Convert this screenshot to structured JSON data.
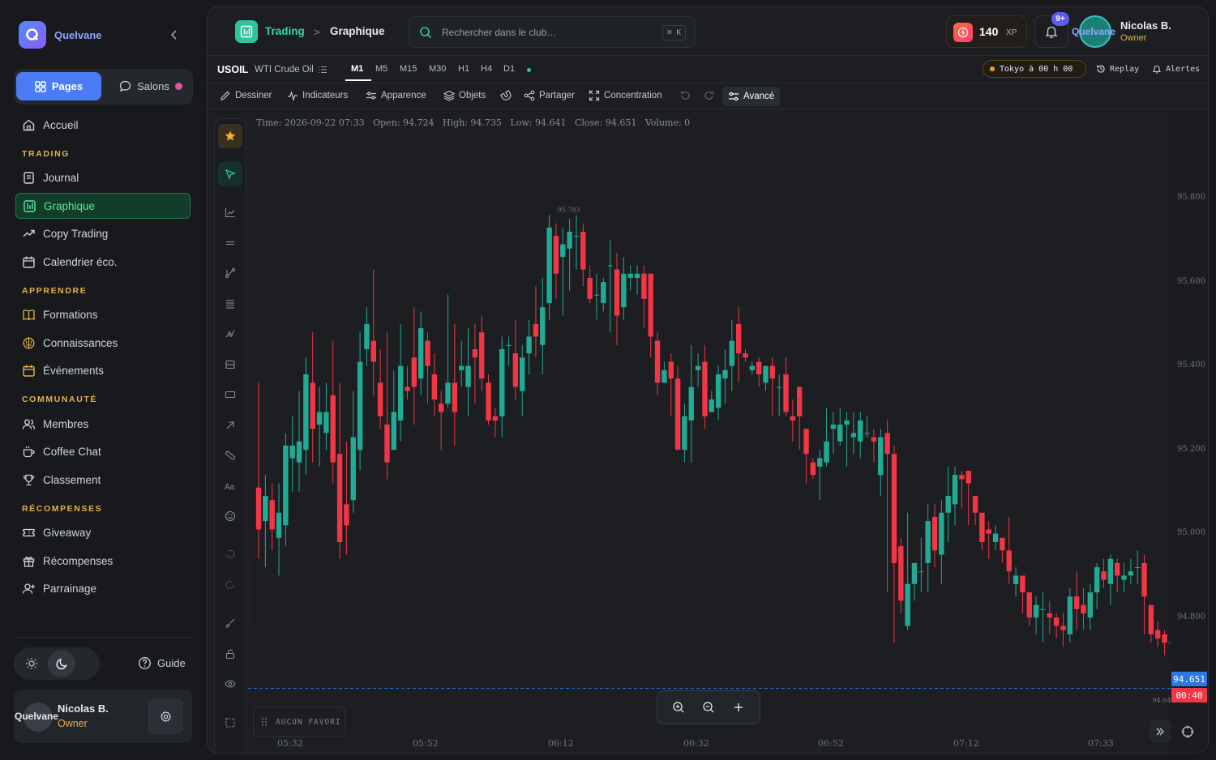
{
  "app": {
    "brand": "Quelvane"
  },
  "sidebar": {
    "tabs": {
      "pages": "Pages",
      "salons": "Salons"
    },
    "sections": {
      "trading": "TRADING",
      "apprendre": "APPRENDRE",
      "communaute": "COMMUNAUTÉ",
      "recompenses": "RÉCOMPENSES"
    },
    "items": {
      "accueil": "Accueil",
      "journal": "Journal",
      "graphique": "Graphique",
      "copy_trading": "Copy Trading",
      "calendrier": "Calendrier éco.",
      "formations": "Formations",
      "connaissances": "Connaissances",
      "evenements": "Événements",
      "membres": "Membres",
      "coffee_chat": "Coffee Chat",
      "classement": "Classement",
      "giveaway": "Giveaway",
      "recompenses": "Récompenses",
      "parrainage": "Parrainage"
    },
    "guide": "Guide",
    "user": {
      "brand": "Quelvane",
      "name": "Nicolas B.",
      "role": "Owner"
    }
  },
  "header": {
    "breadcrumb": {
      "section": "Trading",
      "page": "Graphique",
      "separator": ">"
    },
    "search": {
      "placeholder": "Rechercher dans le club…",
      "shortcut": "⌘ K"
    },
    "xp": {
      "value": "140",
      "unit": "XP"
    },
    "notifications": {
      "badge": "9+"
    },
    "user": {
      "brand": "Quelvane",
      "name": "Nicolas B.",
      "role": "Owner"
    }
  },
  "symbol_bar": {
    "symbol": "USOIL",
    "name": "WTI Crude Oil",
    "timeframes": [
      "M1",
      "M5",
      "M15",
      "M30",
      "H1",
      "H4",
      "D1"
    ],
    "active_timeframe": "M1",
    "session": "Tokyo à 00 h 00",
    "replay": "Replay",
    "alerts": "Alertes"
  },
  "toolbar": {
    "dessiner": "Dessiner",
    "indicateurs": "Indicateurs",
    "apparence": "Apparence",
    "objets": "Objets",
    "partager": "Partager",
    "concentration": "Concentration",
    "avance": "Avancé"
  },
  "ohlc": {
    "time": "Time: 2026-09-22 07:33",
    "open": "Open: 94.724",
    "high": "High: 94.735",
    "low": "Low: 94.641",
    "close": "Close: 94.651",
    "volume": "Volume: 0"
  },
  "favorites": "AUCUN FAVORI",
  "colors": {
    "up": "#22ab94",
    "down": "#f23645",
    "accent": "#2ec4a0",
    "gold": "#e2b24a"
  },
  "chart_data": {
    "type": "candlestick",
    "symbol": "USOIL",
    "timeframe": "M1",
    "ylim": [
      94.58,
      95.88
    ],
    "y_ticks": [
      "95.800",
      "95.600",
      "95.400",
      "95.200",
      "95.000",
      "94.800"
    ],
    "x_ticks": [
      "05:32",
      "05:52",
      "06:12",
      "06:32",
      "06:52",
      "07:12",
      "07:33"
    ],
    "last_price": "94.651",
    "countdown": "00:40",
    "high_marker": "95.783",
    "low_marker": "94.641",
    "start_time": "05:26",
    "end_time": "07:33",
    "candles": [
      [
        95.13,
        95.03,
        95.38,
        94.96
      ],
      [
        95.05,
        95.11,
        95.16,
        94.94
      ],
      [
        95.1,
        95.03,
        95.14,
        94.98
      ],
      [
        95.01,
        95.07,
        95.14,
        94.92
      ],
      [
        95.04,
        95.23,
        95.26,
        94.99
      ],
      [
        95.2,
        95.23,
        95.3,
        95.12
      ],
      [
        95.19,
        95.24,
        95.36,
        95.12
      ],
      [
        95.22,
        95.4,
        95.44,
        95.16
      ],
      [
        95.38,
        95.27,
        95.5,
        95.19
      ],
      [
        95.28,
        95.31,
        95.37,
        95.18
      ],
      [
        95.26,
        95.31,
        95.38,
        95.22
      ],
      [
        95.35,
        95.19,
        95.48,
        95.14
      ],
      [
        95.21,
        95.0,
        95.38,
        94.96
      ],
      [
        95.09,
        95.04,
        95.24,
        94.97
      ],
      [
        95.1,
        95.25,
        95.36,
        95.07
      ],
      [
        95.22,
        95.43,
        95.5,
        95.17
      ],
      [
        95.46,
        95.52,
        95.56,
        95.42
      ],
      [
        95.48,
        95.43,
        95.65,
        95.35
      ],
      [
        95.38,
        95.3,
        95.46,
        95.27
      ],
      [
        95.28,
        95.19,
        95.5,
        95.15
      ],
      [
        95.22,
        95.31,
        95.41,
        95.22
      ],
      [
        95.29,
        95.42,
        95.52,
        95.24
      ],
      [
        95.37,
        95.36,
        95.42,
        95.34
      ],
      [
        95.44,
        95.37,
        95.56,
        95.28
      ],
      [
        95.39,
        95.51,
        95.55,
        95.35
      ],
      [
        95.48,
        95.42,
        95.5,
        95.33
      ],
      [
        95.4,
        95.34,
        95.45,
        95.3
      ],
      [
        95.33,
        95.31,
        95.36,
        95.22
      ],
      [
        95.33,
        95.38,
        95.59,
        95.32
      ],
      [
        95.38,
        95.31,
        95.52,
        95.23
      ],
      [
        95.41,
        95.42,
        95.48,
        95.37
      ],
      [
        95.37,
        95.42,
        95.51,
        95.3
      ],
      [
        95.46,
        95.44,
        95.52,
        95.33
      ],
      [
        95.5,
        95.39,
        95.54,
        95.36
      ],
      [
        95.38,
        95.29,
        95.4,
        95.28
      ],
      [
        95.3,
        95.29,
        95.32,
        95.25
      ],
      [
        95.3,
        95.46,
        95.49,
        95.25
      ],
      [
        95.47,
        95.47,
        95.49,
        95.42
      ],
      [
        95.45,
        95.37,
        95.53,
        95.34
      ],
      [
        95.36,
        95.44,
        95.47,
        95.3
      ],
      [
        95.45,
        95.49,
        95.53,
        95.4
      ],
      [
        95.52,
        95.49,
        95.61,
        95.44
      ],
      [
        95.47,
        95.56,
        95.63,
        95.4
      ],
      [
        95.57,
        95.75,
        95.78,
        95.53
      ],
      [
        95.73,
        95.64,
        95.76,
        95.58
      ],
      [
        95.68,
        95.71,
        95.75,
        95.54
      ],
      [
        95.7,
        95.74,
        95.77,
        95.6
      ],
      [
        95.73,
        95.73,
        95.78,
        95.65
      ],
      [
        95.74,
        95.65,
        95.76,
        95.61
      ],
      [
        95.63,
        95.58,
        95.66,
        95.57
      ],
      [
        95.59,
        95.59,
        95.64,
        95.53
      ],
      [
        95.57,
        95.62,
        95.63,
        95.55
      ],
      [
        95.66,
        95.66,
        95.72,
        95.5
      ],
      [
        95.65,
        95.54,
        95.69,
        95.47
      ],
      [
        95.56,
        95.64,
        95.68,
        95.53
      ],
      [
        95.63,
        95.64,
        95.66,
        95.6
      ],
      [
        95.63,
        95.64,
        95.66,
        95.59
      ],
      [
        95.64,
        95.58,
        95.66,
        95.51
      ],
      [
        95.64,
        95.49,
        95.64,
        95.44
      ],
      [
        95.48,
        95.38,
        95.5,
        95.35
      ],
      [
        95.38,
        95.41,
        95.43,
        95.39
      ],
      [
        95.43,
        95.39,
        95.45,
        95.3
      ],
      [
        95.39,
        95.22,
        95.42,
        95.22
      ],
      [
        95.22,
        95.3,
        95.33,
        95.19
      ],
      [
        95.29,
        95.37,
        95.47,
        95.19
      ],
      [
        95.41,
        95.42,
        95.45,
        95.37
      ],
      [
        95.43,
        95.3,
        95.47,
        95.27
      ],
      [
        95.31,
        95.34,
        95.36,
        95.31
      ],
      [
        95.32,
        95.4,
        95.42,
        95.29
      ],
      [
        95.39,
        95.41,
        95.46,
        95.33
      ],
      [
        95.42,
        95.48,
        95.53,
        95.36
      ],
      [
        95.52,
        95.45,
        95.56,
        95.38
      ],
      [
        95.45,
        95.44,
        95.46,
        95.43
      ],
      [
        95.41,
        95.42,
        95.43,
        95.4
      ],
      [
        95.43,
        95.4,
        95.44,
        95.37
      ],
      [
        95.38,
        95.42,
        95.42,
        95.36
      ],
      [
        95.42,
        95.39,
        95.44,
        95.3
      ],
      [
        95.37,
        95.37,
        95.4,
        95.3
      ],
      [
        95.4,
        95.31,
        95.44,
        95.3
      ],
      [
        95.3,
        95.29,
        95.34,
        95.24
      ],
      [
        95.37,
        95.3,
        95.36,
        95.22
      ],
      [
        95.27,
        95.21,
        95.26,
        95.14
      ],
      [
        95.19,
        95.16,
        95.2,
        95.15
      ],
      [
        95.18,
        95.2,
        95.22,
        95.1
      ],
      [
        95.19,
        95.24,
        95.32,
        95.18
      ],
      [
        95.27,
        95.28,
        95.31,
        95.21
      ],
      [
        95.24,
        95.28,
        95.32,
        95.23
      ],
      [
        95.28,
        95.29,
        95.31,
        95.18
      ],
      [
        95.25,
        95.26,
        95.31,
        95.21
      ],
      [
        95.24,
        95.29,
        95.31,
        95.2
      ],
      [
        95.26,
        95.26,
        95.3,
        95.25
      ],
      [
        95.25,
        95.24,
        95.27,
        95.19
      ],
      [
        95.16,
        95.25,
        95.27,
        95.11
      ],
      [
        95.26,
        95.21,
        95.29,
        94.88
      ],
      [
        95.21,
        94.95,
        95.23,
        94.76
      ],
      [
        94.99,
        94.86,
        95.01,
        94.83
      ],
      [
        94.8,
        94.9,
        95.07,
        94.79
      ],
      [
        94.9,
        94.95,
        94.95,
        94.86
      ],
      [
        94.93,
        94.93,
        95.01,
        94.88
      ],
      [
        94.95,
        95.05,
        95.09,
        94.88
      ],
      [
        95.06,
        94.98,
        95.09,
        94.94
      ],
      [
        94.97,
        95.07,
        95.1,
        94.9
      ],
      [
        95.07,
        95.11,
        95.18,
        95.0
      ],
      [
        95.09,
        95.16,
        95.18,
        95.04
      ],
      [
        95.16,
        95.15,
        95.17,
        95.08
      ],
      [
        95.17,
        95.14,
        95.15,
        95.04
      ],
      [
        95.11,
        95.07,
        95.11,
        95.04
      ],
      [
        95.07,
        95.0,
        95.05,
        94.98
      ],
      [
        95.03,
        95.02,
        95.05,
        94.96
      ],
      [
        95.0,
        95.02,
        95.04,
        94.98
      ],
      [
        95.01,
        94.98,
        95.0,
        94.95
      ],
      [
        94.98,
        94.93,
        95.06,
        94.9
      ],
      [
        94.9,
        94.92,
        94.94,
        94.87
      ],
      [
        94.92,
        94.88,
        94.89,
        94.83
      ],
      [
        94.88,
        94.82,
        94.85,
        94.8
      ],
      [
        94.82,
        94.85,
        94.87,
        94.78
      ],
      [
        94.84,
        94.84,
        94.88,
        94.76
      ],
      [
        94.83,
        94.82,
        94.86,
        94.78
      ],
      [
        94.82,
        94.8,
        94.83,
        94.77
      ],
      [
        94.8,
        94.79,
        94.83,
        94.75
      ],
      [
        94.78,
        94.87,
        94.89,
        94.76
      ],
      [
        94.87,
        94.84,
        94.93,
        94.79
      ],
      [
        94.85,
        94.83,
        94.89,
        94.79
      ],
      [
        94.82,
        94.88,
        94.9,
        94.79
      ],
      [
        94.88,
        94.94,
        94.95,
        94.84
      ],
      [
        94.93,
        94.91,
        94.96,
        94.89
      ],
      [
        94.9,
        94.96,
        94.97,
        94.85
      ],
      [
        94.95,
        94.92,
        94.96,
        94.88
      ],
      [
        94.91,
        94.92,
        94.95,
        94.88
      ],
      [
        94.92,
        94.93,
        94.96,
        94.9
      ],
      [
        94.94,
        94.94,
        94.98,
        94.9
      ],
      [
        94.95,
        94.87,
        94.97,
        94.78
      ],
      [
        94.85,
        94.78,
        94.84,
        94.76
      ],
      [
        94.79,
        94.77,
        94.81,
        94.75
      ],
      [
        94.78,
        94.76,
        94.79,
        94.73
      ],
      [
        94.76,
        94.76,
        94.79,
        94.74
      ],
      [
        94.75,
        94.73,
        94.78,
        94.69
      ],
      [
        94.724,
        94.651,
        94.735,
        94.641
      ]
    ]
  }
}
